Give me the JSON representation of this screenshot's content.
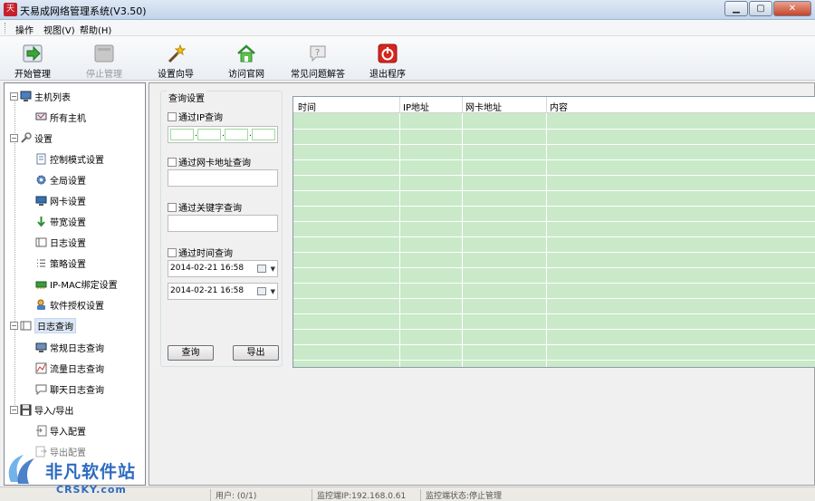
{
  "window": {
    "title": "天易成网络管理系统(V3.50)",
    "app_icon_text": "天",
    "min": "▁",
    "max": "▢",
    "close": "✕"
  },
  "menu": {
    "items": [
      "操作",
      "视图(V)",
      "帮助(H)"
    ]
  },
  "toolbar": {
    "items": [
      {
        "label": "开始管理",
        "enabled": true
      },
      {
        "label": "停止管理",
        "enabled": false
      },
      {
        "label": "设置向导",
        "enabled": true
      },
      {
        "label": "访问官网",
        "enabled": true
      },
      {
        "label": "常见问题解答",
        "enabled": true
      },
      {
        "label": "退出程序",
        "enabled": true
      }
    ]
  },
  "tree": {
    "host_list": "主机列表",
    "all_hosts": "所有主机",
    "settings": "设置",
    "control_mode": "控制模式设置",
    "global": "全局设置",
    "nic": "网卡设置",
    "bandwidth": "带宽设置",
    "log_settings": "日志设置",
    "policy": "策略设置",
    "ip_mac": "IP-MAC绑定设置",
    "license": "软件授权设置",
    "log_query": "日志查询",
    "normal_log": "常规日志查询",
    "traffic_log": "流量日志查询",
    "chat_log": "聊天日志查询",
    "import_export": "导入/导出",
    "import_cfg": "导入配置",
    "export_cfg": "导出配置"
  },
  "query": {
    "group_title": "查询设置",
    "by_ip": "通过IP查询",
    "by_mac": "通过网卡地址查询",
    "by_keyword": "通过关键字查询",
    "by_time": "通过时间查询",
    "from_time": "2014-02-21 16:58",
    "to_time": "2014-02-21 16:58",
    "query_button": "查询",
    "export_button": "导出"
  },
  "grid": {
    "columns": [
      "时间",
      "IP地址",
      "网卡地址",
      "内容"
    ],
    "row_count": 16
  },
  "status": {
    "user": "用户: (0/1)",
    "monitor_ip": "监控端IP:192.168.0.61",
    "monitor_state": "监控端状态:停止管理"
  },
  "watermark": {
    "cn": "非凡软件站",
    "en": "CRSKY.com"
  },
  "colors": {
    "grid_bg": "#c9e9c9",
    "accent": "#2e6bc0"
  }
}
